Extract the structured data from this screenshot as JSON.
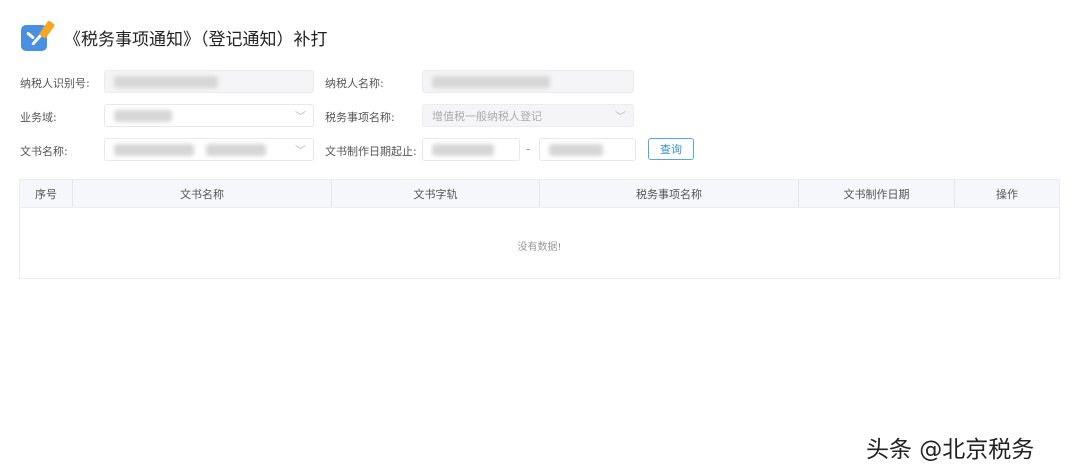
{
  "header": {
    "title": "《税务事项通知》（登记通知）补打",
    "icon": "task-check-icon"
  },
  "form": {
    "taxpayer_id_label": "纳税人识别号:",
    "taxpayer_name_label": "纳税人名称:",
    "business_domain_label": "业务域:",
    "tax_item_name_label": "税务事项名称:",
    "tax_item_name_value": "增值税一般纳税人登记",
    "doc_name_label": "文书名称:",
    "doc_date_range_label": "文书制作日期起止:",
    "date_separator": "-",
    "query_button": "查询"
  },
  "table": {
    "columns": [
      "序号",
      "文书名称",
      "文书字轨",
      "税务事项名称",
      "文书制作日期",
      "操作"
    ],
    "rows": [],
    "empty_text": "没有数据!"
  },
  "watermark": "头条 @北京税务"
}
